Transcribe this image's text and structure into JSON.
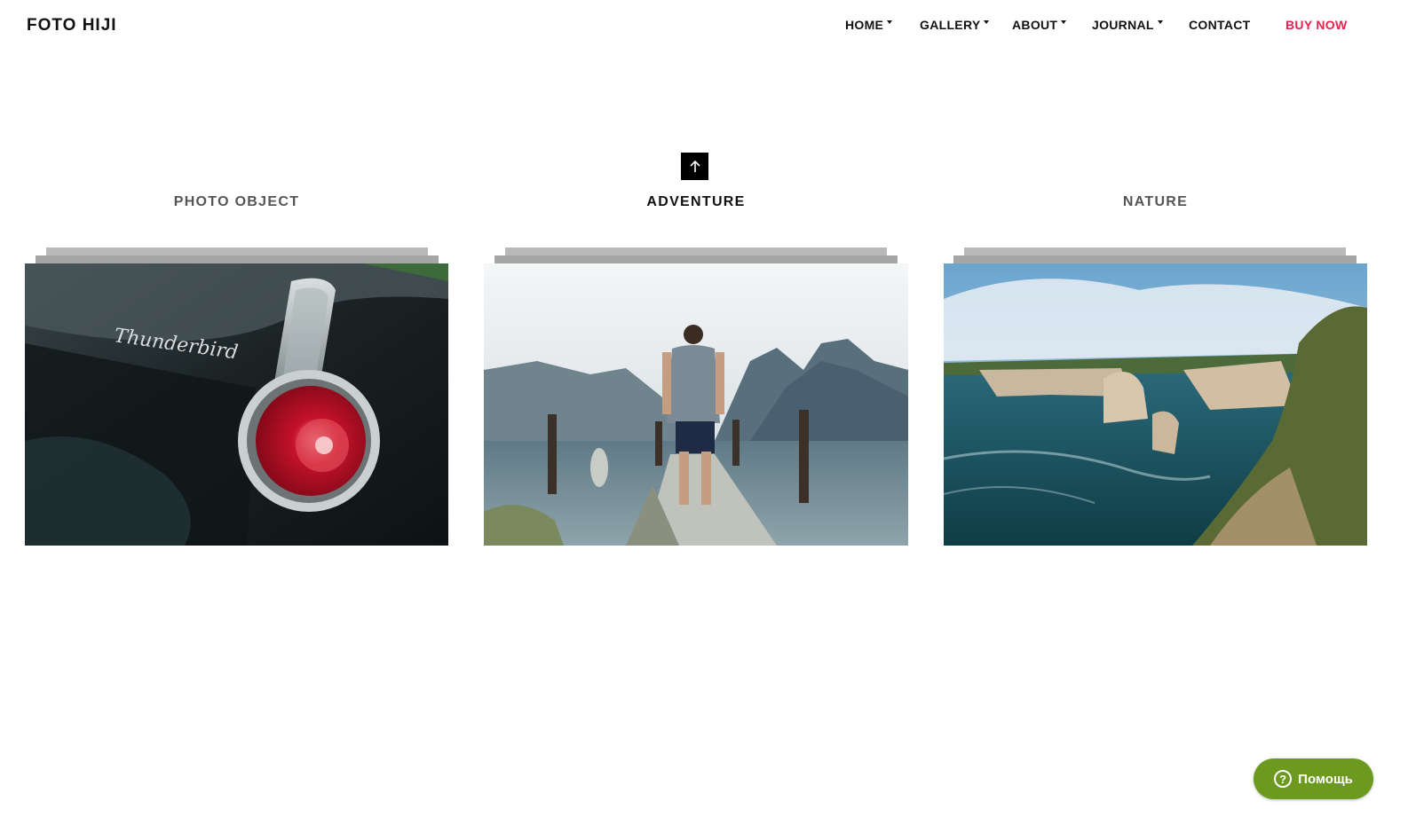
{
  "header": {
    "brand": "FOTO HIJI",
    "nav": [
      {
        "label": "HOME",
        "has_dropdown": true
      },
      {
        "label": "GALLERY",
        "has_dropdown": true
      },
      {
        "label": "ABOUT",
        "has_dropdown": true
      },
      {
        "label": "JOURNAL",
        "has_dropdown": true
      },
      {
        "label": "CONTACT",
        "has_dropdown": false
      },
      {
        "label": "BUY NOW",
        "has_dropdown": false,
        "color": "#e5234c"
      }
    ]
  },
  "scroll_top": {
    "icon": "arrow-up-icon"
  },
  "categories": [
    {
      "label": "PHOTO OBJECT",
      "active": false,
      "image": "car-taillight-photo"
    },
    {
      "label": "ADVENTURE",
      "active": true,
      "image": "man-on-pier-photo"
    },
    {
      "label": "NATURE",
      "active": false,
      "image": "coastal-cliffs-photo"
    }
  ],
  "help_widget": {
    "label": "Помощь",
    "icon": "question-circle-icon",
    "color": "#6b9a1e"
  }
}
